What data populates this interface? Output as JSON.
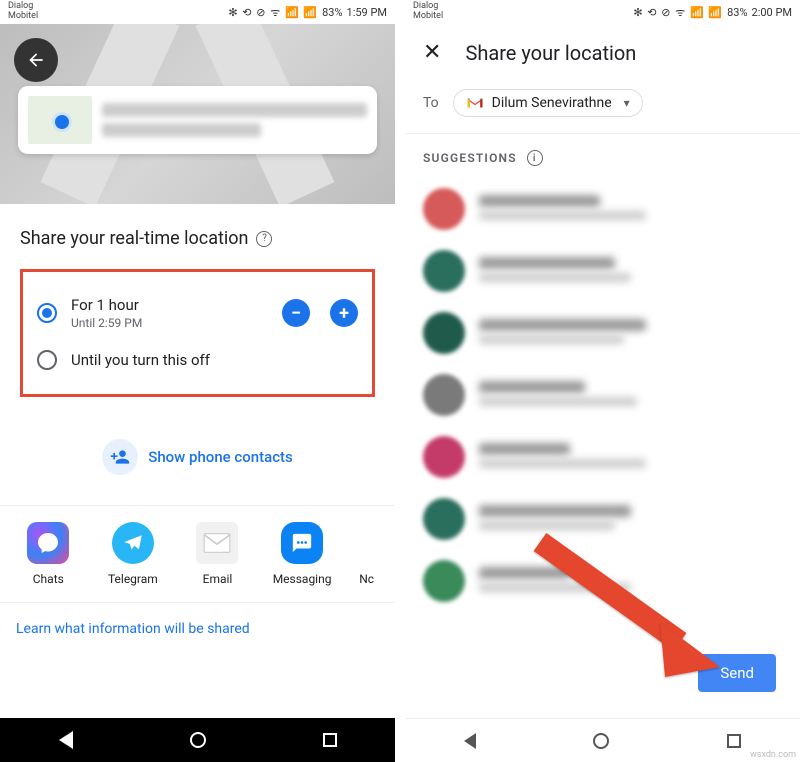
{
  "status": {
    "carrier": "Dialog\nMobitel",
    "battery": "83%",
    "time_left": "1:59 PM",
    "time_right": "2:00 PM",
    "icons": "✻ ⎋ ⊘ ᯤ 📶 📶"
  },
  "left": {
    "title": "Share your real-time location",
    "options": {
      "for_hour": {
        "label": "For 1 hour",
        "sub": "Until 2:59 PM"
      },
      "until_off": {
        "label": "Until you turn this off"
      }
    },
    "contacts_label": "Show phone contacts",
    "targets": {
      "chats": "Chats",
      "telegram": "Telegram",
      "email": "Email",
      "messaging": "Messaging",
      "next": "Nc"
    },
    "info": "Learn what information will be shared"
  },
  "right": {
    "title": "Share your location",
    "to_label": "To",
    "recipient": "Dilum Senevirathne",
    "suggestions_label": "SUGGESTIONS",
    "send": "Send"
  },
  "watermark": "wsxdn.com",
  "colors": {
    "avatars": [
      "#d65a5a",
      "#2a6e5e",
      "#1f5a4a",
      "#7a7a7a",
      "#c43b6a",
      "#2a6e5e",
      "#3a8a5a"
    ]
  }
}
